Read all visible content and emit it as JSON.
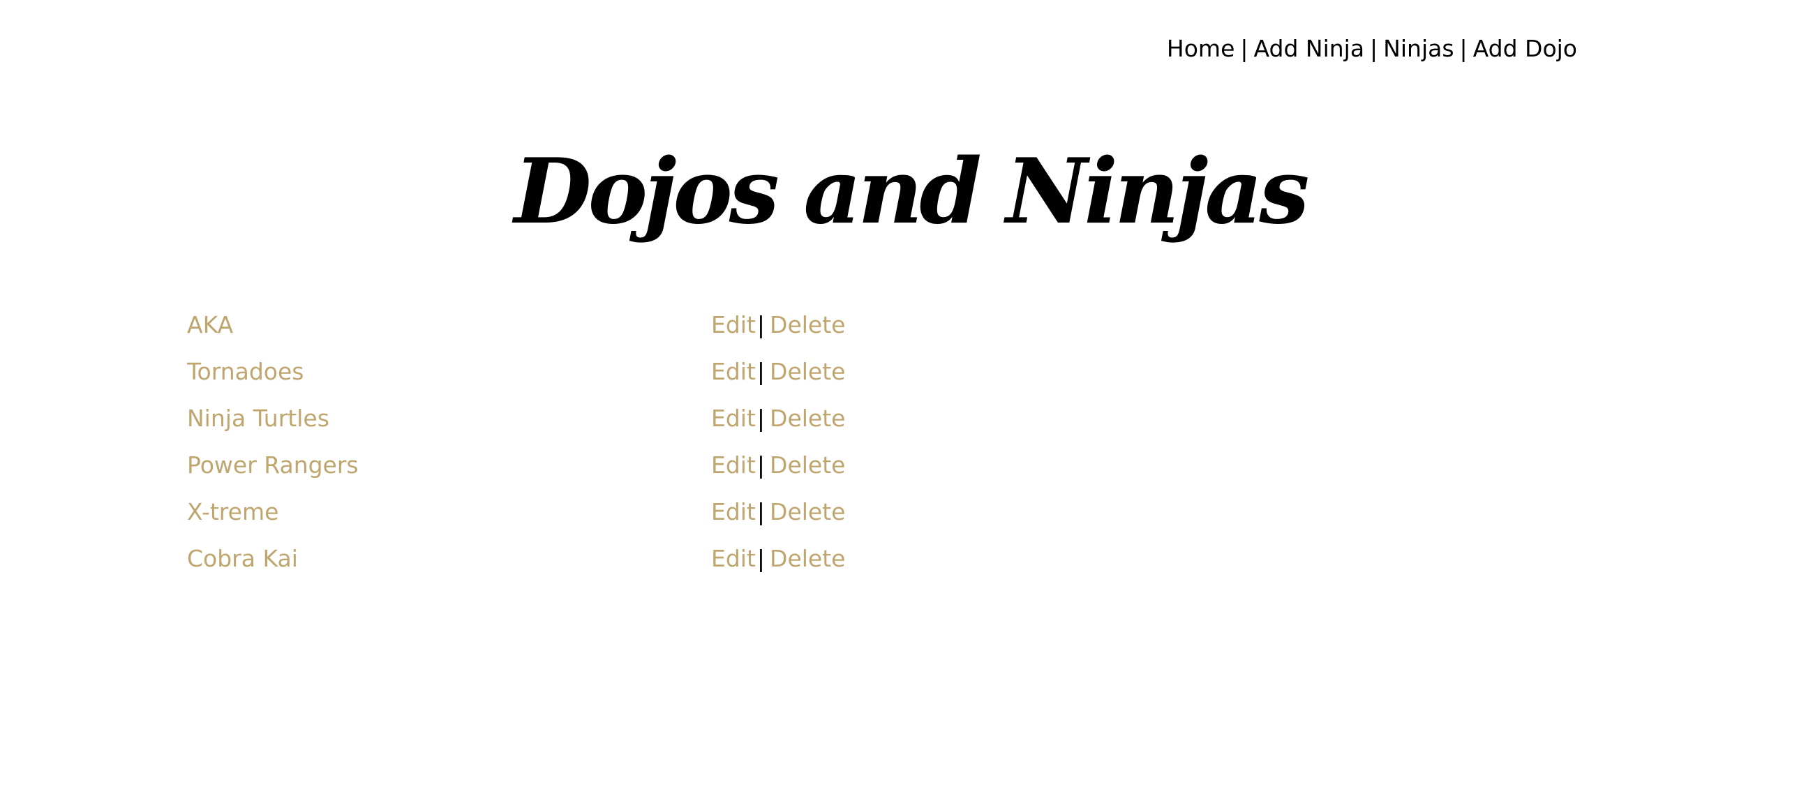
{
  "nav": {
    "home": "Home",
    "add_ninja": "Add Ninja",
    "ninjas": "Ninjas",
    "add_dojo": "Add Dojo",
    "separator": "|"
  },
  "page": {
    "title": "Dojos and Ninjas"
  },
  "dojos": [
    {
      "name": "AKA",
      "edit": "Edit",
      "delete": "Delete"
    },
    {
      "name": "Tornadoes",
      "edit": "Edit",
      "delete": "Delete"
    },
    {
      "name": "Ninja Turtles",
      "edit": "Edit",
      "delete": "Delete"
    },
    {
      "name": "Power Rangers",
      "edit": "Edit",
      "delete": "Delete"
    },
    {
      "name": "X-treme",
      "edit": "Edit",
      "delete": "Delete"
    },
    {
      "name": "Cobra Kai",
      "edit": "Edit",
      "delete": "Delete"
    }
  ],
  "action_separator": "|",
  "colors": {
    "link": "#bfa66f",
    "text": "#000000",
    "background": "#ffffff"
  }
}
